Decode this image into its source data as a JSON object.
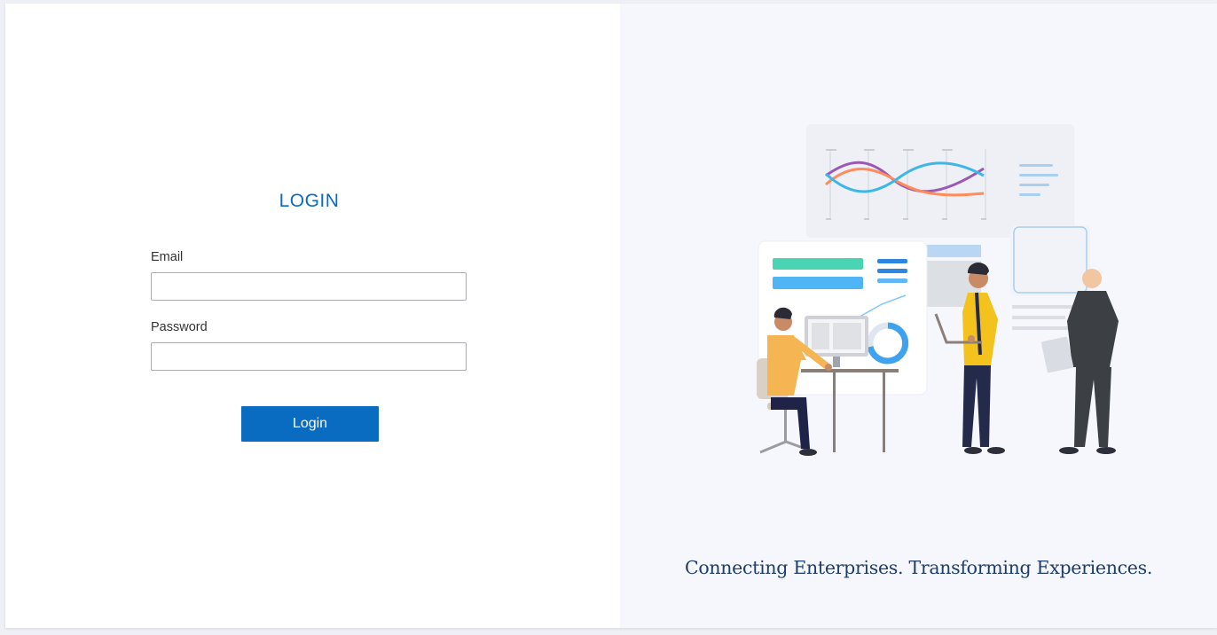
{
  "login": {
    "title": "LOGIN",
    "email_label": "Email",
    "email_value": "",
    "password_label": "Password",
    "password_value": "",
    "button_label": "Login"
  },
  "brand": {
    "tagline": "Connecting Enterprises. Transforming Experiences."
  },
  "illustration": {
    "icon": "office-team-analytics-illustration"
  },
  "colors": {
    "accent": "#0a6cc0",
    "panel_background": "#f6f7fc",
    "tagline": "#1d3e6b"
  }
}
